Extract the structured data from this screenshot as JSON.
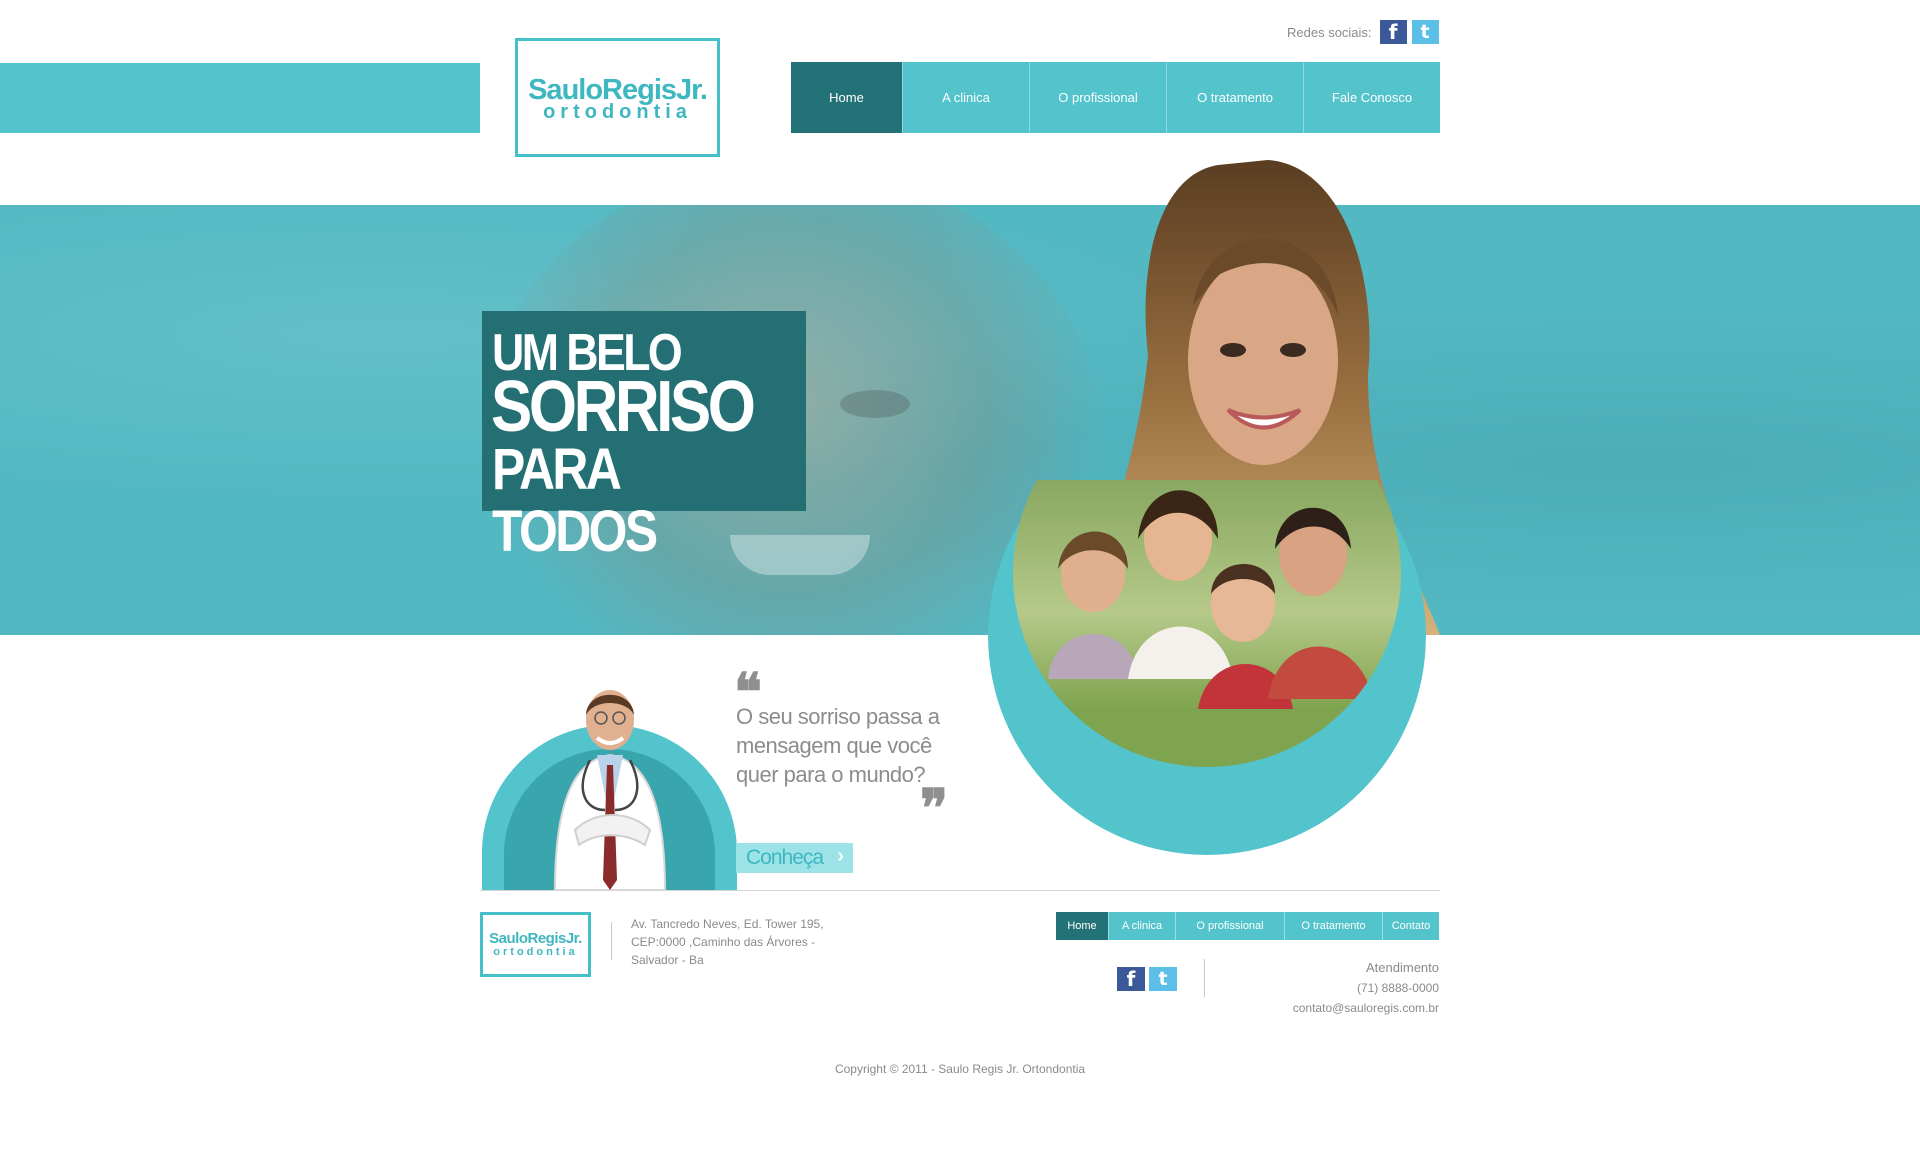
{
  "header": {
    "logo": {
      "name": "SauloRegisJr.",
      "sub": "ortodontia"
    },
    "social_label": "Redes sociais:",
    "social_icons": [
      "facebook-icon",
      "twitter-icon"
    ],
    "nav": [
      {
        "label": "Home",
        "active": true
      },
      {
        "label": "A clinica",
        "active": false
      },
      {
        "label": "O profissional",
        "active": false
      },
      {
        "label": "O tratamento",
        "active": false
      },
      {
        "label": "Fale Conosco",
        "active": false
      }
    ]
  },
  "hero": {
    "line1": "UM BELO",
    "line2": "SORRISO",
    "line3": "PARA TODOS"
  },
  "content": {
    "quote_open": "❝",
    "quote_close": "❞",
    "quote": "O seu sorriso passa a mensagem que você quer para o mundo?",
    "button": "Conheça",
    "button_arrow": "›"
  },
  "footer": {
    "logo": {
      "name": "SauloRegisJr.",
      "sub": "ortodontia"
    },
    "address_line1": "Av. Tancredo Neves, Ed. Tower 195,",
    "address_line2": "CEP:0000 ,Caminho das Árvores -",
    "address_line3": "Salvador - Ba",
    "nav": [
      {
        "label": "Home",
        "active": true
      },
      {
        "label": "A clinica",
        "active": false
      },
      {
        "label": "O profissional",
        "active": false
      },
      {
        "label": "O tratamento",
        "active": false
      },
      {
        "label": "Contato",
        "active": false
      }
    ],
    "contact_title": "Atendimento",
    "phone": "(71) 8888-0000",
    "email": "contato@sauloregis.com.br",
    "copyright": "Copyright © 2011 - Saulo Regis Jr. Ortondontia"
  },
  "colors": {
    "accent": "#53c4cc",
    "dark_accent": "#237278",
    "facebook": "#3b5998",
    "twitter": "#5cbfe8"
  }
}
